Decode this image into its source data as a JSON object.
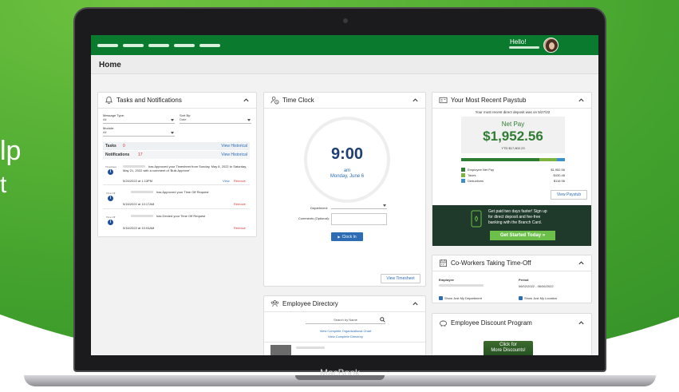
{
  "background": {
    "partial_text_1": "lp",
    "partial_text_2": "t",
    "accent": "#43a22d"
  },
  "laptop": {
    "brand": "MacBook"
  },
  "header": {
    "greeting": "Hello!",
    "menu_icon": "menu-dash-icon",
    "brand_color": "#0a7a2e"
  },
  "page": {
    "title": "Home"
  },
  "tasks": {
    "title": "Tasks and Notifications",
    "filters": {
      "message_type_label": "Message Type:",
      "message_type_value": "All",
      "sort_by_label": "Sort By:",
      "sort_by_value": "Date",
      "module_label": "Module:",
      "module_value": "All"
    },
    "tasks_label": "Tasks",
    "tasks_count": "0",
    "notifications_label": "Notifications",
    "notifications_count": "17",
    "view_historical": "View Historical",
    "items": [
      {
        "tag": "Timesheet",
        "badge": "i",
        "text": "has Approved your Timesheet from Sunday, May 8, 2022 to Saturday, May 21, 2022 with a comment of 'Bulk Approve'",
        "date": "5/24/2022 at 1:13PM",
        "view": "View",
        "remove": "Remove"
      },
      {
        "tag": "Time Off",
        "badge": "i",
        "text": "has Approved your Time Off Request",
        "date": "5/16/2022 at 10:17AM",
        "remove": "Remove"
      },
      {
        "tag": "Time Off",
        "badge": "i",
        "text": "has Denied your Time Off Request",
        "date": "5/16/2022 at 10:03AM",
        "remove": "Remove"
      }
    ]
  },
  "timeclock": {
    "title": "Time Clock",
    "time": "9:00",
    "ampm": "am",
    "date": "Monday, June 6",
    "department_label": "Department:",
    "comments_label": "Comments (Optional):",
    "clock_in": "Clock In",
    "view_timesheet": "View Timesheet"
  },
  "directory": {
    "title": "Employee Directory",
    "search_placeholder": "Search by Name",
    "org_chart": "View Complete Organizational Chart",
    "complete_directory": "View Complete Directory"
  },
  "paystub": {
    "title": "Your Most Recent Paystub",
    "deposit_note": "Your most recent direct deposit was on 5/27/22",
    "net_pay_label": "Net Pay",
    "net_pay": "$1,952.56",
    "ytd": "YTD $17,802.23",
    "breakdown": [
      {
        "label": "Employee Net Pay",
        "amount": "$1,952.56",
        "color": "#2e7d32",
        "share": 0.75
      },
      {
        "label": "Taxes",
        "amount": "$430.48",
        "color": "#7cb342",
        "share": 0.17
      },
      {
        "label": "Deductions",
        "amount": "$116.96",
        "color": "#3e8ec8",
        "share": 0.08
      }
    ],
    "view_paystub": "View Paystub",
    "promo_line1": "Get paid two days faster! Sign up",
    "promo_line2": "for direct deposit and fee-free",
    "promo_line3": "banking with the Branch Card.",
    "promo_button": "Get Started Today »"
  },
  "coworkers": {
    "title": "Co-Workers Taking Time-Off",
    "employee_header": "Employee",
    "period_header": "Period",
    "period_value": "06/02/2022 - 06/06/2022",
    "show_department": "Show Just My Department",
    "show_location": "Show Just My Location"
  },
  "discount": {
    "title": "Employee Discount Program",
    "banner_line1": "Click for",
    "banner_line2": "More Discounts!"
  }
}
